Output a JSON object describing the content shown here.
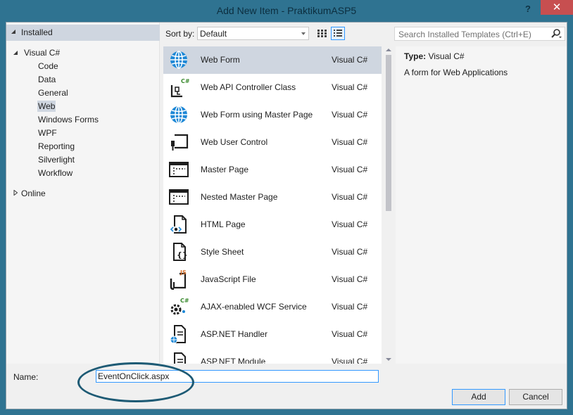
{
  "window": {
    "title": "Add New Item - PraktikumASP5",
    "help_label": "?",
    "close_label": "✕"
  },
  "tree": {
    "installed_label": "Installed",
    "visual_csharp_label": "Visual C#",
    "children": [
      "Code",
      "Data",
      "General",
      "Web",
      "Windows Forms",
      "WPF",
      "Reporting",
      "Silverlight",
      "Workflow"
    ],
    "selected_child": "Web",
    "online_label": "Online"
  },
  "toolbar": {
    "sort_label": "Sort by:",
    "sort_value": "Default",
    "search_placeholder": "Search Installed Templates (Ctrl+E)"
  },
  "templates": [
    {
      "name": "Web Form",
      "lang": "Visual C#",
      "icon": "globe-icon",
      "selected": true
    },
    {
      "name": "Web API Controller Class",
      "lang": "Visual C#",
      "icon": "csharp-class-icon"
    },
    {
      "name": "Web Form using Master Page",
      "lang": "Visual C#",
      "icon": "globe-icon"
    },
    {
      "name": "Web User Control",
      "lang": "Visual C#",
      "icon": "user-control-icon"
    },
    {
      "name": "Master Page",
      "lang": "Visual C#",
      "icon": "master-page-icon"
    },
    {
      "name": "Nested Master Page",
      "lang": "Visual C#",
      "icon": "master-page-icon"
    },
    {
      "name": "HTML Page",
      "lang": "Visual C#",
      "icon": "html-page-icon"
    },
    {
      "name": "Style Sheet",
      "lang": "Visual C#",
      "icon": "stylesheet-icon"
    },
    {
      "name": "JavaScript File",
      "lang": "Visual C#",
      "icon": "javascript-icon"
    },
    {
      "name": "AJAX-enabled WCF Service",
      "lang": "Visual C#",
      "icon": "wcf-service-icon"
    },
    {
      "name": "ASP.NET Handler",
      "lang": "Visual C#",
      "icon": "handler-icon"
    },
    {
      "name": "ASP.NET Module",
      "lang": "Visual C#",
      "icon": "module-icon"
    }
  ],
  "details": {
    "type_label": "Type:",
    "type_value": "Visual C#",
    "description": "A form for Web Applications"
  },
  "footer": {
    "name_label": "Name:",
    "name_value": "EventOnClick.aspx",
    "add_label": "Add",
    "cancel_label": "Cancel"
  },
  "colors": {
    "selection": "#cfd6e0",
    "accent_blue": "#3399ff",
    "icon_blue": "#1e88d6",
    "csharp_green": "#3a8a2e",
    "js_orange": "#d9712b",
    "close_red": "#c74f50",
    "annotation_ellipse": "#1d5a74"
  }
}
